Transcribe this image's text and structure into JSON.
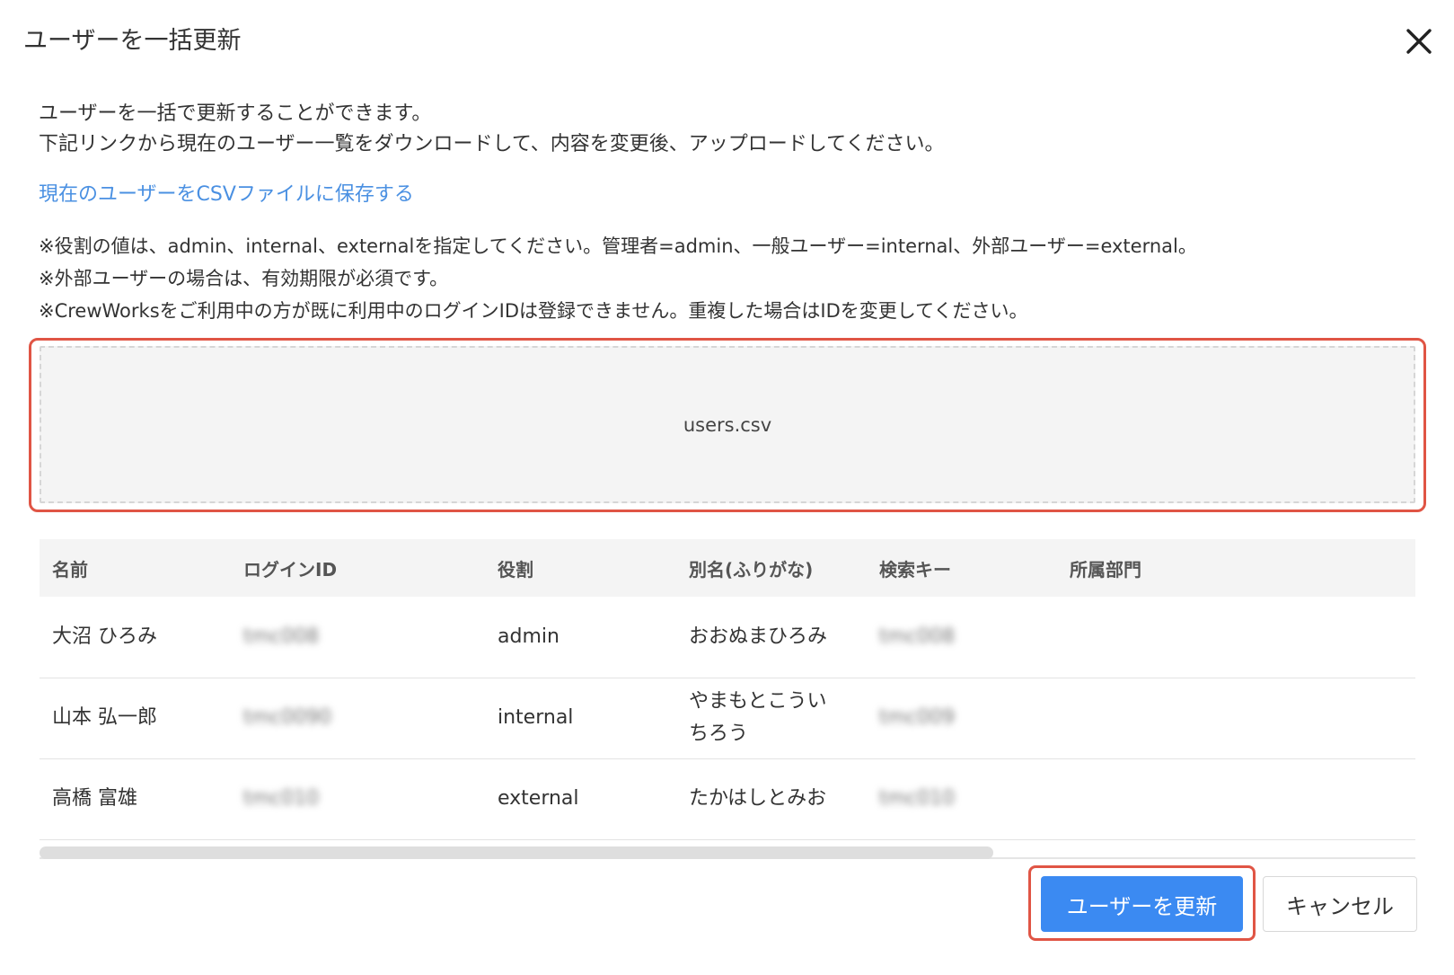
{
  "dialog": {
    "title": "ユーザーを一括更新",
    "close_icon": "close-icon"
  },
  "description": [
    "ユーザーを一括で更新することができます。",
    "下記リンクから現在のユーザー一覧をダウンロードして、内容を変更後、アップロードしてください。"
  ],
  "download_link": "現在のユーザーをCSVファイルに保存する",
  "notes": [
    "※役割の値は、admin、internal、externalを指定してください。管理者=admin、一般ユーザー=internal、外部ユーザー=external。",
    "※外部ユーザーの場合は、有効期限が必須です。",
    "※CrewWorksをご利用中の方が既に利用中のログインIDは登録できません。重複した場合はIDを変更してください。"
  ],
  "dropzone": {
    "filename": "users.csv"
  },
  "table": {
    "headers": [
      "名前",
      "ログインID",
      "役割",
      "別名(ふりがな)",
      "検索キー",
      "所属部門"
    ],
    "rows": [
      [
        "大沼 ひろみ",
        "tmc008",
        "admin",
        "おおぬまひろみ",
        "tmc008",
        ""
      ],
      [
        "山本 弘一郎",
        "tmc0090",
        "internal",
        "やまもとこういちろう",
        "tmc009",
        ""
      ],
      [
        "高橋 富雄",
        "tmc010",
        "external",
        "たかはしとみお",
        "tmc010",
        ""
      ]
    ]
  },
  "buttons": {
    "update": "ユーザーを更新",
    "cancel": "キャンセル"
  },
  "colors": {
    "accent": "#3b8af2",
    "link": "#4a90e2",
    "highlight": "#e05545"
  }
}
